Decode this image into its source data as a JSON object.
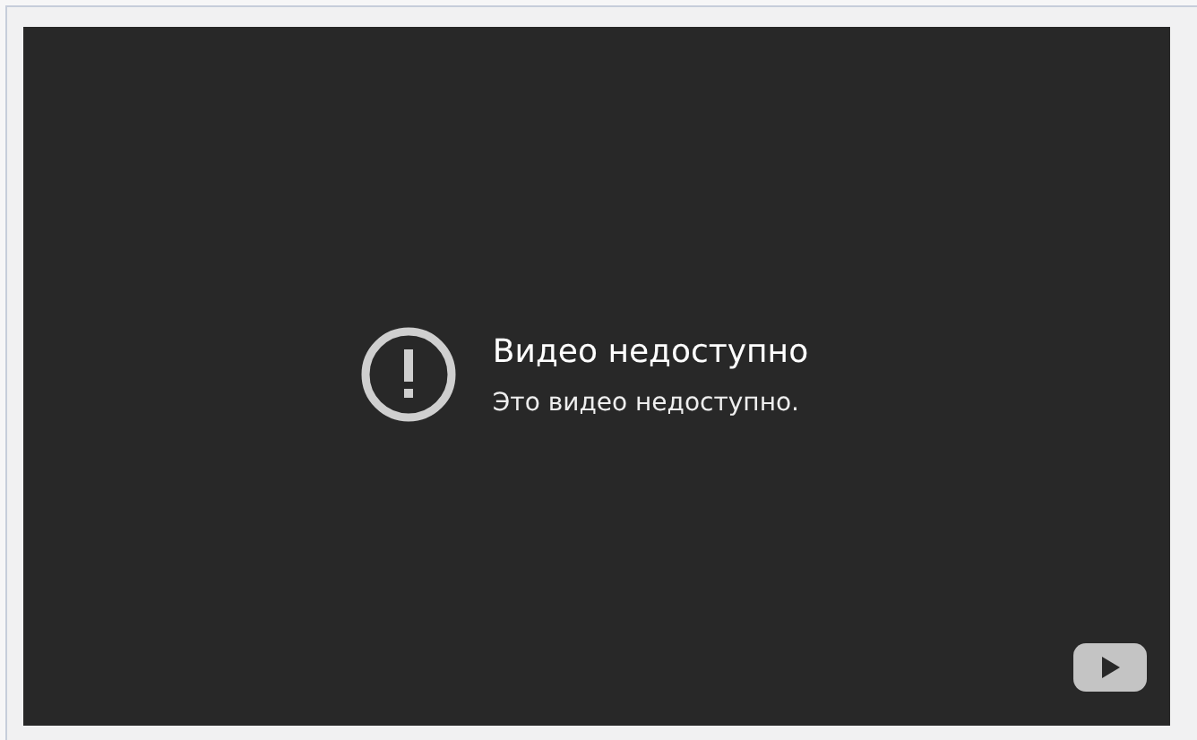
{
  "player": {
    "error_title": "Видео недоступно",
    "error_message": "Это видео недоступно."
  }
}
